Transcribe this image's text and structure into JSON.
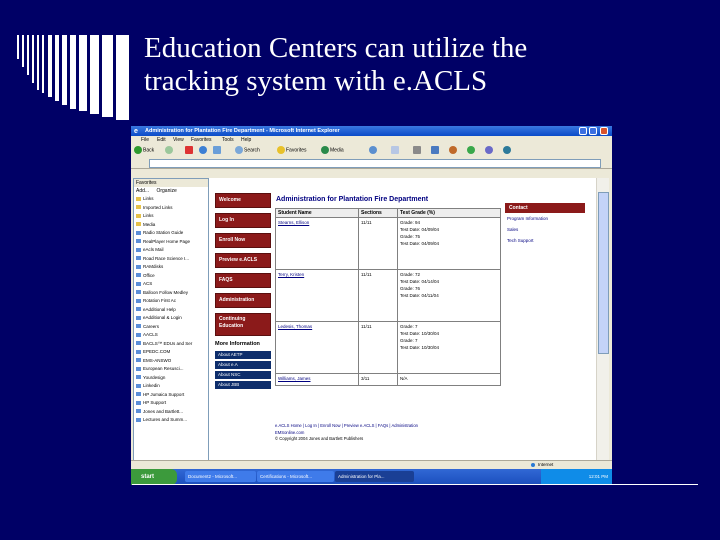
{
  "slide": {
    "title_line1": "Education Centers can utilize the",
    "title_line2": "tracking system with e.ACLS"
  },
  "browser": {
    "window_title": "Administration for Plantation Fire Department - Microsoft Internet Explorer",
    "menu": [
      "File",
      "Edit",
      "View",
      "Favorites",
      "Tools",
      "Help"
    ],
    "toolbar": {
      "back": "Back",
      "search": "Search",
      "favorites": "Favorites",
      "media": "Media"
    },
    "status_text": "Internet"
  },
  "favorites_panel": {
    "header": "Favorites",
    "add": "Add...",
    "organize": "Organize",
    "items": [
      "Links",
      "Imported Links",
      "Links",
      "Media",
      "Radio Station Guide",
      "RealPlayer Home Page",
      "eAcls Mail",
      "Road Race Science I...",
      "RAMdisks",
      "Office",
      "ACS",
      "Balloon Follow Medley",
      "Rotation First Ac",
      "eAdditional Help",
      "eAdditional & Login",
      "Careers",
      "AACLS",
      "BACLS™ EDUs and Ser",
      "EPEDC.COM",
      "EMS-ANSWO",
      "European Resusci...",
      "Yourdesign",
      "Linkedin",
      "HP Jumaica Support",
      "HP Support",
      "Jones and Bartlett...",
      "Lectures and Summ..."
    ]
  },
  "page": {
    "heading": "Administration for Plantation Fire Department",
    "nav": {
      "welcome": "Welcome",
      "login": "Log In",
      "enroll": "Enroll Now",
      "preview": "Preview e.ACLS",
      "faqs": "FAQS",
      "administration": "Administration",
      "continuing": "Continuing Education"
    },
    "more_info_label": "More Information",
    "info_links": [
      "About AETP",
      "About e.A",
      "About NSC",
      "About JBB"
    ],
    "table": {
      "headers": {
        "student": "Student Name",
        "sections": "Sections",
        "grade": "Test Grade (%)"
      },
      "rows": [
        {
          "name": "Stearns, Ellison",
          "sections": "11/11",
          "g1": "Grade: 94",
          "d1": "Test Date: 04/09/04",
          "g2": "Grade: 75",
          "d2": "Test Date: 04/09/04"
        },
        {
          "name": "Terry, Kristen",
          "sections": "11/11",
          "g1": "Grade: 72",
          "d1": "Test Date: 04/14/04",
          "g2": "Grade: 76",
          "d2": "Test Date: 04/11/04"
        },
        {
          "name": "Ledesis, Thomas",
          "sections": "11/11",
          "g1": "Grade: 7",
          "d1": "Test Date: 10/30/04",
          "g2": "Grade: 7",
          "d2": "Test Date: 10/30/04"
        },
        {
          "name": "Williams, James",
          "sections": "3/11",
          "g1": "N/A",
          "d1": "",
          "g2": "",
          "d2": ""
        }
      ]
    },
    "sidebar_right": {
      "contact": "Contact",
      "links": [
        "Program Information",
        "Sales",
        "Tech Support"
      ]
    },
    "footer": {
      "line1": "e.ACLS Home | Log In | Enroll Now | Preview e.ACLS | FAQs | Administration",
      "line2": "EMSonline.com",
      "line3": "© Copyright 2004 Jones and Bartlett Publishers"
    }
  },
  "taskbar": {
    "start": "start",
    "tasks": [
      "Document2 - Microsoft...",
      "Certifications - Microsoft...",
      "Administration for Pla..."
    ],
    "clock": "12:01 PM"
  }
}
